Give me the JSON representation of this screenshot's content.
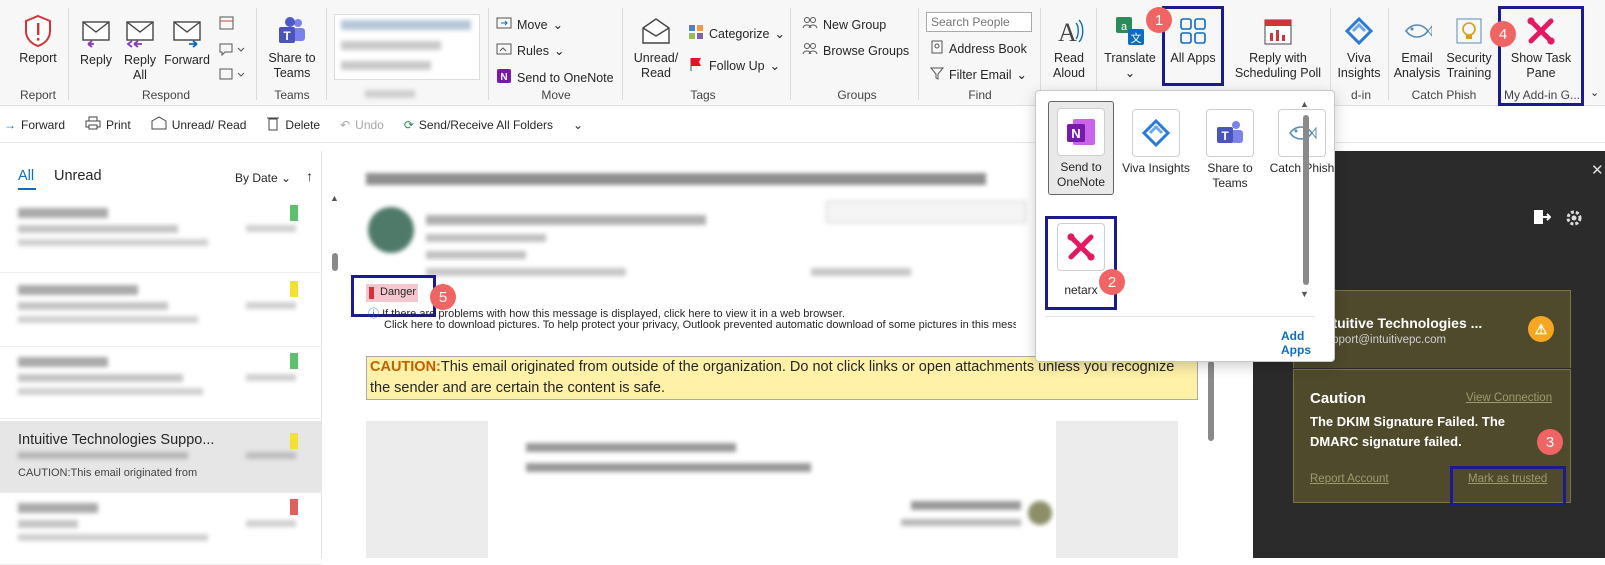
{
  "ribbon": {
    "report": {
      "label": "Report",
      "group": "Report"
    },
    "respond": {
      "reply": "Reply",
      "reply_all": "Reply All",
      "forward": "Forward",
      "group": "Respond"
    },
    "teams": {
      "share": "Share to Teams",
      "group": "Teams"
    },
    "move": {
      "move": "Move",
      "rules": "Rules",
      "onenote": "Send to OneNote",
      "group": "Move"
    },
    "tags": {
      "unread": "Unread/ Read",
      "categorize": "Categorize",
      "followup": "Follow Up",
      "group": "Tags"
    },
    "groups": {
      "new": "New Group",
      "browse": "Browse Groups",
      "group": "Groups"
    },
    "find": {
      "search_placeholder": "Search People",
      "address": "Address Book",
      "filter": "Filter Email",
      "group": "Find"
    },
    "read_aloud": "Read Aloud",
    "translate": "Translate",
    "all_apps": "All Apps",
    "scheduling": "Reply with Scheduling Poll",
    "viva": "Viva Insights",
    "addin_group_partial": "d-in",
    "email_analysis": "Email Analysis",
    "security_training": "Security Training",
    "catch_phish_group": "Catch Phish",
    "show_task_pane": "Show Task Pane",
    "my_addin_group": "My Add-in G..."
  },
  "qat": {
    "forward": "Forward",
    "print": "Print",
    "unread": "Unread/ Read",
    "delete": "Delete",
    "undo": "Undo",
    "sendreceive": "Send/Receive All Folders"
  },
  "list": {
    "tab_all": "All",
    "tab_unread": "Unread",
    "sort": "By Date",
    "selected": {
      "sender": "Intuitive Technologies Suppo...",
      "preview": "CAUTION:This email originated from"
    }
  },
  "message": {
    "danger": "Danger",
    "info1": "If there are problems with how this message is displayed, click here to view it in a web browser.",
    "info2": "Click here to download pictures. To help protect your privacy, Outlook prevented automatic download of some pictures in this message.",
    "caution_label": "CAUTION:",
    "caution_text": "This email originated from outside of the organization. Do not click links or open attachments unless you recognize the sender and are certain the content is safe."
  },
  "popup": {
    "apps": [
      "Send to OneNote",
      "Viva Insights",
      "Share to Teams",
      "Catch Phish"
    ],
    "netarx": "netarx",
    "add_apps": "Add Apps"
  },
  "sidepane": {
    "sender_name": "Intuitive Technologies ...",
    "sender_email": "support@intuitivepc.com",
    "caution_title": "Caution",
    "view_connection": "View Connection",
    "caution_body": "The DKIM Signature Failed. The DMARC signature failed.",
    "report_account": "Report Account",
    "mark_trusted": "Mark as trusted"
  },
  "badges": [
    "1",
    "2",
    "3",
    "4",
    "5"
  ],
  "colors": {
    "annotation_box": "#1b1b8f",
    "badge": "#f06464",
    "outlook_blue": "#0f6cbd",
    "netarx": "#e5195f",
    "caution_bg": "#fff2a8"
  }
}
